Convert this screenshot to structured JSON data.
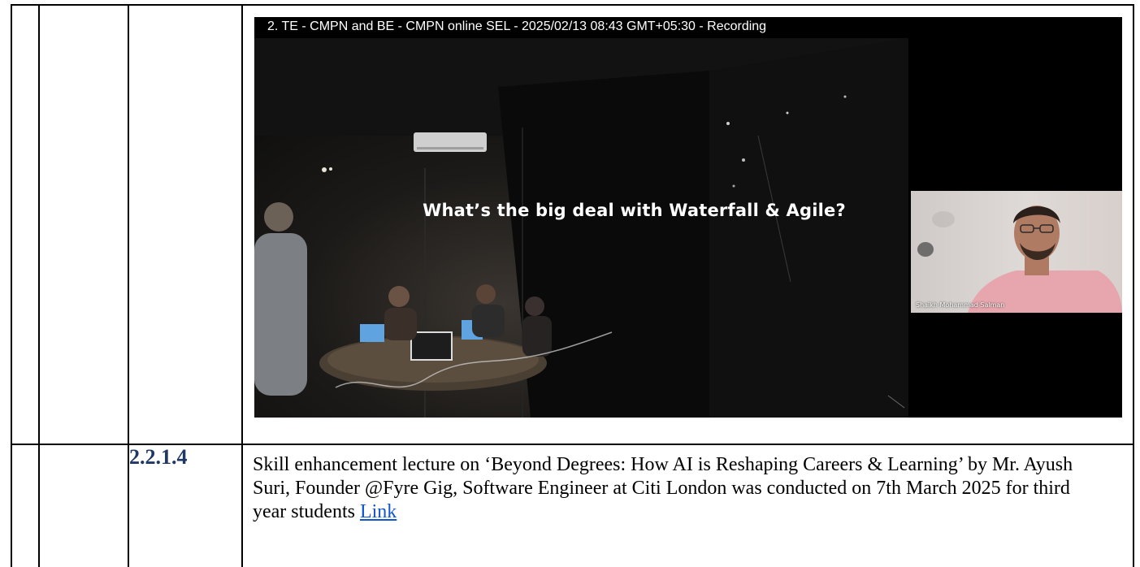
{
  "recording": {
    "title": "2. TE - CMPN and BE - CMPN online SEL - 2025/02/13 08:43 GMT+05:30 - Recording",
    "slide_headline": "What’s the big deal with Waterfall & Agile?",
    "participant_name": "Shaikh Mohammad Salman"
  },
  "entry": {
    "number": "2.2.1.4",
    "description": "Skill enhancement lecture on ‘Beyond Degrees: How AI is Reshaping Careers & Learning’  by Mr. Ayush Suri, Founder @Fyre Gig, Software Engineer at Citi London was conducted on  7th March 2025  for third year students ",
    "link_label": "Link"
  },
  "colors": {
    "number_text": "#1f3864",
    "link": "#1155cc",
    "border": "#000000"
  }
}
